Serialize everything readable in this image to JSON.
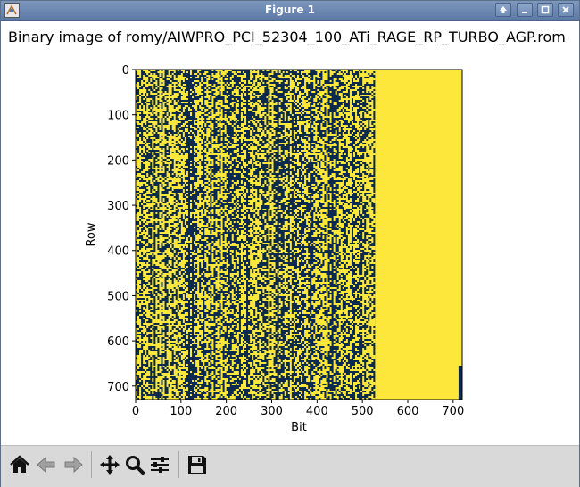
{
  "window": {
    "title": "Figure 1"
  },
  "figure": {
    "title": "Binary image of romy/AIWPRO_PCI_52304_100_ATi_RAGE_RP_TURBO_AGP.rom",
    "xlabel": "Bit",
    "ylabel": "Row",
    "xticks": [
      "0",
      "100",
      "200",
      "300",
      "400",
      "500",
      "600",
      "700"
    ],
    "yticks": [
      "0",
      "100",
      "200",
      "300",
      "400",
      "500",
      "600",
      "700"
    ],
    "colors": {
      "zero": "#0b2a4e",
      "one": "#fde73a"
    }
  },
  "chart_data": {
    "type": "heatmap",
    "title": "Binary image of romy/AIWPRO_PCI_52304_100_ATi_RAGE_RP_TURBO_AGP.rom",
    "xlabel": "Bit",
    "ylabel": "Row",
    "xlim": [
      0,
      720
    ],
    "ylim": [
      730,
      0
    ],
    "value_range": [
      0,
      1
    ],
    "colormap": "viridis-binary",
    "regions": [
      {
        "name": "random bits",
        "x_range": [
          0,
          528
        ],
        "y_range": [
          0,
          730
        ],
        "ones_fraction": 0.5
      },
      {
        "name": "all ones",
        "x_range": [
          528,
          720
        ],
        "y_range": [
          0,
          730
        ],
        "value": 1
      },
      {
        "name": "zeros corner",
        "x_range": [
          712,
          720
        ],
        "y_range": [
          655,
          730
        ],
        "value": 0
      }
    ]
  },
  "toolbar": {
    "buttons": [
      {
        "id": "home",
        "icon": "home-icon"
      },
      {
        "id": "back",
        "icon": "back-arrow-icon"
      },
      {
        "id": "forward",
        "icon": "forward-arrow-icon"
      },
      {
        "id": "pan",
        "icon": "move-icon"
      },
      {
        "id": "zoom",
        "icon": "zoom-icon"
      },
      {
        "id": "configure",
        "icon": "sliders-icon"
      },
      {
        "id": "save",
        "icon": "save-icon"
      }
    ]
  }
}
